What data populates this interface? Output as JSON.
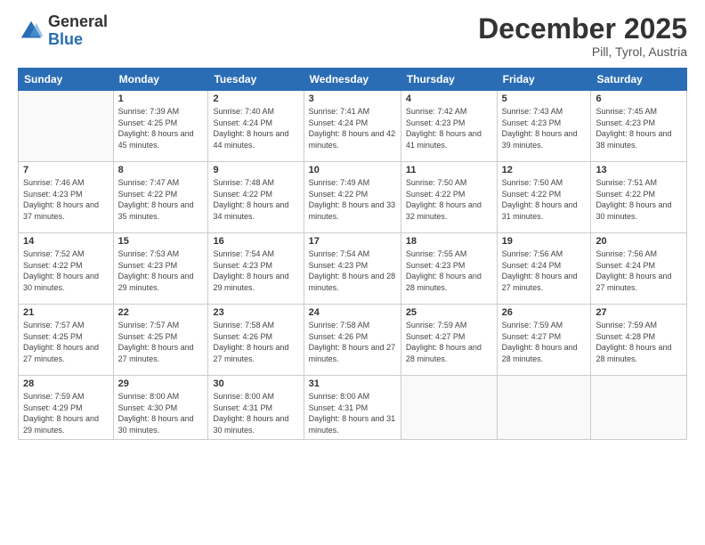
{
  "header": {
    "logo_general": "General",
    "logo_blue": "Blue",
    "month_year": "December 2025",
    "location": "Pill, Tyrol, Austria"
  },
  "weekdays": [
    "Sunday",
    "Monday",
    "Tuesday",
    "Wednesday",
    "Thursday",
    "Friday",
    "Saturday"
  ],
  "weeks": [
    [
      {
        "day": "",
        "sunrise": "",
        "sunset": "",
        "daylight": ""
      },
      {
        "day": "1",
        "sunrise": "7:39 AM",
        "sunset": "4:25 PM",
        "daylight": "8 hours and 45 minutes."
      },
      {
        "day": "2",
        "sunrise": "7:40 AM",
        "sunset": "4:24 PM",
        "daylight": "8 hours and 44 minutes."
      },
      {
        "day": "3",
        "sunrise": "7:41 AM",
        "sunset": "4:24 PM",
        "daylight": "8 hours and 42 minutes."
      },
      {
        "day": "4",
        "sunrise": "7:42 AM",
        "sunset": "4:23 PM",
        "daylight": "8 hours and 41 minutes."
      },
      {
        "day": "5",
        "sunrise": "7:43 AM",
        "sunset": "4:23 PM",
        "daylight": "8 hours and 39 minutes."
      },
      {
        "day": "6",
        "sunrise": "7:45 AM",
        "sunset": "4:23 PM",
        "daylight": "8 hours and 38 minutes."
      }
    ],
    [
      {
        "day": "7",
        "sunrise": "7:46 AM",
        "sunset": "4:23 PM",
        "daylight": "8 hours and 37 minutes."
      },
      {
        "day": "8",
        "sunrise": "7:47 AM",
        "sunset": "4:22 PM",
        "daylight": "8 hours and 35 minutes."
      },
      {
        "day": "9",
        "sunrise": "7:48 AM",
        "sunset": "4:22 PM",
        "daylight": "8 hours and 34 minutes."
      },
      {
        "day": "10",
        "sunrise": "7:49 AM",
        "sunset": "4:22 PM",
        "daylight": "8 hours and 33 minutes."
      },
      {
        "day": "11",
        "sunrise": "7:50 AM",
        "sunset": "4:22 PM",
        "daylight": "8 hours and 32 minutes."
      },
      {
        "day": "12",
        "sunrise": "7:50 AM",
        "sunset": "4:22 PM",
        "daylight": "8 hours and 31 minutes."
      },
      {
        "day": "13",
        "sunrise": "7:51 AM",
        "sunset": "4:22 PM",
        "daylight": "8 hours and 30 minutes."
      }
    ],
    [
      {
        "day": "14",
        "sunrise": "7:52 AM",
        "sunset": "4:22 PM",
        "daylight": "8 hours and 30 minutes."
      },
      {
        "day": "15",
        "sunrise": "7:53 AM",
        "sunset": "4:23 PM",
        "daylight": "8 hours and 29 minutes."
      },
      {
        "day": "16",
        "sunrise": "7:54 AM",
        "sunset": "4:23 PM",
        "daylight": "8 hours and 29 minutes."
      },
      {
        "day": "17",
        "sunrise": "7:54 AM",
        "sunset": "4:23 PM",
        "daylight": "8 hours and 28 minutes."
      },
      {
        "day": "18",
        "sunrise": "7:55 AM",
        "sunset": "4:23 PM",
        "daylight": "8 hours and 28 minutes."
      },
      {
        "day": "19",
        "sunrise": "7:56 AM",
        "sunset": "4:24 PM",
        "daylight": "8 hours and 27 minutes."
      },
      {
        "day": "20",
        "sunrise": "7:56 AM",
        "sunset": "4:24 PM",
        "daylight": "8 hours and 27 minutes."
      }
    ],
    [
      {
        "day": "21",
        "sunrise": "7:57 AM",
        "sunset": "4:25 PM",
        "daylight": "8 hours and 27 minutes."
      },
      {
        "day": "22",
        "sunrise": "7:57 AM",
        "sunset": "4:25 PM",
        "daylight": "8 hours and 27 minutes."
      },
      {
        "day": "23",
        "sunrise": "7:58 AM",
        "sunset": "4:26 PM",
        "daylight": "8 hours and 27 minutes."
      },
      {
        "day": "24",
        "sunrise": "7:58 AM",
        "sunset": "4:26 PM",
        "daylight": "8 hours and 27 minutes."
      },
      {
        "day": "25",
        "sunrise": "7:59 AM",
        "sunset": "4:27 PM",
        "daylight": "8 hours and 28 minutes."
      },
      {
        "day": "26",
        "sunrise": "7:59 AM",
        "sunset": "4:27 PM",
        "daylight": "8 hours and 28 minutes."
      },
      {
        "day": "27",
        "sunrise": "7:59 AM",
        "sunset": "4:28 PM",
        "daylight": "8 hours and 28 minutes."
      }
    ],
    [
      {
        "day": "28",
        "sunrise": "7:59 AM",
        "sunset": "4:29 PM",
        "daylight": "8 hours and 29 minutes."
      },
      {
        "day": "29",
        "sunrise": "8:00 AM",
        "sunset": "4:30 PM",
        "daylight": "8 hours and 30 minutes."
      },
      {
        "day": "30",
        "sunrise": "8:00 AM",
        "sunset": "4:31 PM",
        "daylight": "8 hours and 30 minutes."
      },
      {
        "day": "31",
        "sunrise": "8:00 AM",
        "sunset": "4:31 PM",
        "daylight": "8 hours and 31 minutes."
      },
      {
        "day": "",
        "sunrise": "",
        "sunset": "",
        "daylight": ""
      },
      {
        "day": "",
        "sunrise": "",
        "sunset": "",
        "daylight": ""
      },
      {
        "day": "",
        "sunrise": "",
        "sunset": "",
        "daylight": ""
      }
    ]
  ],
  "labels": {
    "sunrise_prefix": "Sunrise: ",
    "sunset_prefix": "Sunset: ",
    "daylight_prefix": "Daylight: "
  }
}
